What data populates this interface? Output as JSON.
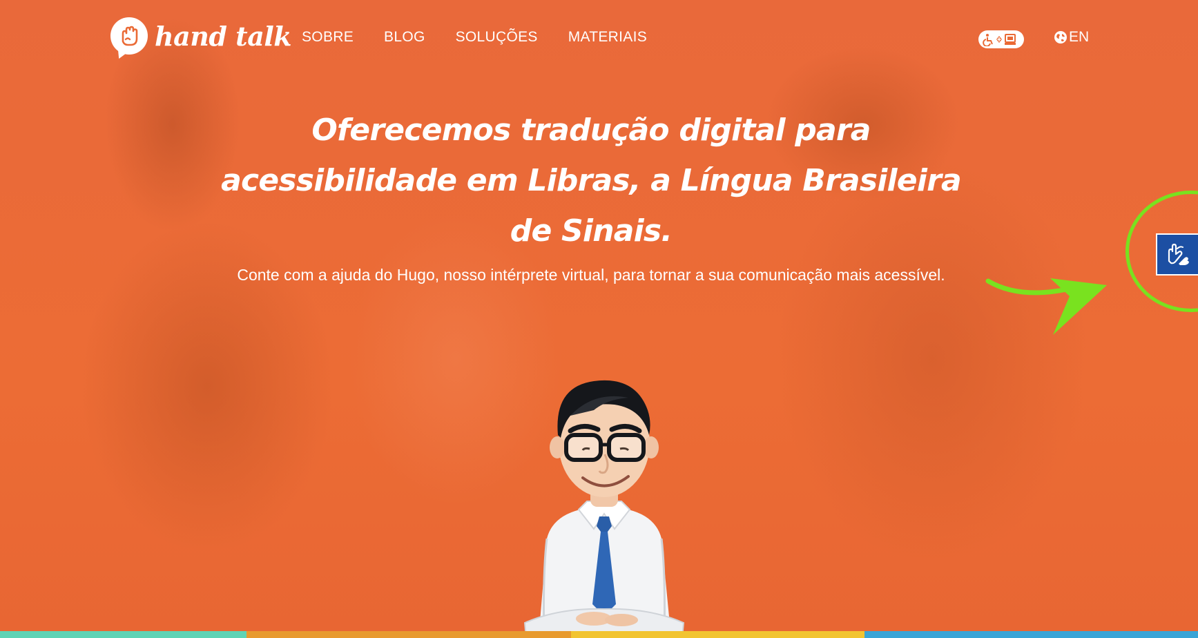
{
  "brand": {
    "name": "hand talk"
  },
  "nav": {
    "items": [
      {
        "label": "SOBRE"
      },
      {
        "label": "BLOG"
      },
      {
        "label": "SOLUÇÕES"
      },
      {
        "label": "MATERIAIS"
      }
    ]
  },
  "header": {
    "accessibility_icon": "wheelchair-accessibility-icon",
    "language_label": "EN",
    "language_icon": "globe-icon"
  },
  "hero": {
    "title": "Oferecemos tradução digital para acessibilidade em Libras, a Língua Brasileira de Sinais.",
    "subtitle": "Conte com a ajuda do Hugo, nosso intérprete virtual, para tornar a sua comunicação mais acessível."
  },
  "widget": {
    "icon": "sign-language-hands-icon"
  },
  "colors": {
    "background": "#ea6a35",
    "widget_blue": "#1c4fa3",
    "highlight_green": "#79e21f",
    "bar_colors": [
      "#5fd3b5",
      "#e89a2e",
      "#f2c431",
      "#3aa4d6"
    ]
  }
}
